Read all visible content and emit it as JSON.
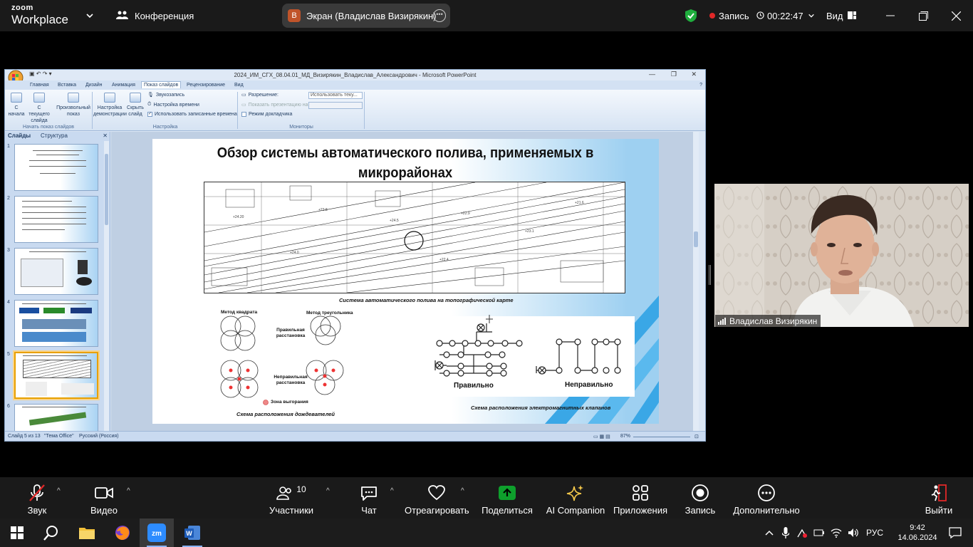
{
  "zoom_top": {
    "logo_line1": "zoom",
    "logo_line2": "Workplace",
    "meeting_label": "Конференция",
    "share_avatar": "В",
    "share_label": "Экран (Владислав Визирякин)",
    "recording_label": "Запись",
    "timer": "00:22:47",
    "view_label": "Вид"
  },
  "ppt": {
    "window_title": "2024_ИМ_СГХ_08.04.01_МД_Визирякин_Владислав_Александрович - Microsoft PowerPoint",
    "tabs": [
      "Главная",
      "Вставка",
      "Дизайн",
      "Анимация",
      "Показ слайдов",
      "Рецензирование",
      "Вид"
    ],
    "active_tab": "Показ слайдов",
    "ribbon": {
      "btn_from_start": "С начала",
      "btn_from_current": "С текущего слайда",
      "btn_custom": "Произвольный показ",
      "group_start": "Начать показ слайдов",
      "btn_setup": "Настройка демонстрации",
      "btn_hide": "Скрыть слайд",
      "opt_record": "Звукозапись",
      "opt_timing": "Настройка времени",
      "opt_use_timing": "Использовать записанные времена",
      "group_setup": "Настройка",
      "res_label": "Разрешение:",
      "res_value": "Использовать теку...",
      "show_on_label": "Показать презентацию на:",
      "presenter_label": "Режим докладчика",
      "group_monitors": "Мониторы"
    },
    "pane_tabs": [
      "Слайды",
      "Структура"
    ],
    "thumb_numbers": [
      "1",
      "2",
      "3",
      "4",
      "5",
      "6"
    ],
    "selected_thumb": "5",
    "slide": {
      "title": "Обзор системы автоматического полива, применяемых в микрорайонах",
      "map_caption": "Система автоматического полива на топографической карте",
      "method_square": "Метод квадрата",
      "method_triangle": "Метод треугольника",
      "correct_spacing": "Правильная расстановка",
      "incorrect_spacing": "Неправильная расстановка",
      "dry_zone": "Зона выгорания",
      "sprinkler_caption": "Схема расположения дождевателей",
      "correct": "Правильно",
      "incorrect": "Неправильно",
      "valve_caption": "Схема расположения электромагнитных клапанов"
    },
    "status": {
      "slide_of": "Слайд 5 из 13",
      "theme": "\"Тема Office\"",
      "language": "Русский (Россия)",
      "zoom": "87%"
    }
  },
  "camera": {
    "participant_name": "Владислав Визирякин"
  },
  "zoom_bottom": {
    "audio": "Звук",
    "video": "Видео",
    "participants": "Участники",
    "participants_count": "10",
    "chat": "Чат",
    "react": "Отреагировать",
    "share": "Поделиться",
    "ai": "AI Companion",
    "apps": "Приложения",
    "record": "Запись",
    "more": "Дополнительно",
    "leave": "Выйти"
  },
  "taskbar": {
    "lang": "РУС",
    "time": "9:42",
    "date": "14.06.2024",
    "apps": [
      "start",
      "search",
      "explorer",
      "firefox",
      "zoom",
      "word"
    ]
  },
  "colors": {
    "zoom_bg": "#1a1a1a",
    "record_dot": "#e02828",
    "share_green": "#0e9f2c",
    "leave_red": "#e02828",
    "ppt_blue": "#dbe6f4"
  }
}
